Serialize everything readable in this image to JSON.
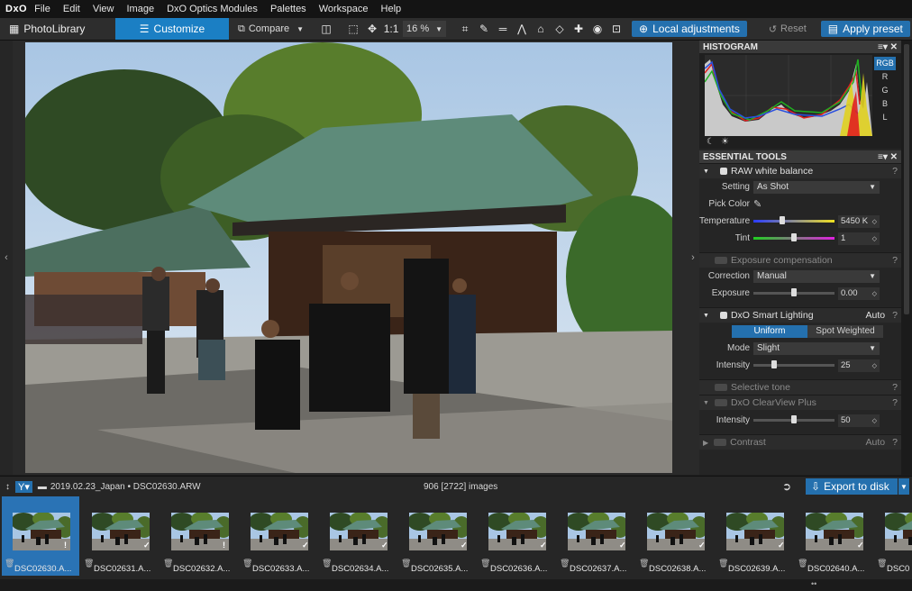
{
  "menu": {
    "logo": "DxO",
    "items": [
      "File",
      "Edit",
      "View",
      "Image",
      "DxO Optics Modules",
      "Palettes",
      "Workspace",
      "Help"
    ]
  },
  "toolbar": {
    "photolibrary": "PhotoLibrary",
    "customize": "Customize",
    "compare": "Compare",
    "one_to_one": "1:1",
    "zoom": "16 %",
    "local_adjustments": "Local adjustments",
    "reset": "Reset",
    "apply_preset": "Apply preset"
  },
  "histogram": {
    "title": "HISTOGRAM",
    "channels": [
      "RGB",
      "R",
      "G",
      "B",
      "L"
    ]
  },
  "essential_tools": {
    "title": "ESSENTIAL TOOLS",
    "raw_white_balance": {
      "title": "RAW white balance",
      "setting_label": "Setting",
      "setting_value": "As Shot",
      "pick_color_label": "Pick Color",
      "temperature_label": "Temperature",
      "temperature_value": "5450 K",
      "temperature_pos": 0.35,
      "tint_label": "Tint",
      "tint_value": "1",
      "tint_pos": 0.5
    },
    "exposure": {
      "title": "Exposure compensation",
      "correction_label": "Correction",
      "correction_value": "Manual",
      "exposure_label": "Exposure",
      "exposure_value": "0.00",
      "exposure_pos": 0.5
    },
    "smart_lighting": {
      "title": "DxO Smart Lighting",
      "state": "Auto",
      "mode_uniform": "Uniform",
      "mode_spot": "Spot Weighted",
      "mode_label": "Mode",
      "mode_value": "Slight",
      "intensity_label": "Intensity",
      "intensity_value": "25",
      "intensity_pos": 0.25
    },
    "selective_tone": {
      "title": "Selective tone"
    },
    "clearview": {
      "title": "DxO ClearView Plus",
      "intensity_label": "Intensity",
      "intensity_value": "50",
      "intensity_pos": 0.5
    },
    "contrast": {
      "title": "Contrast",
      "state": "Auto"
    }
  },
  "pathbar": {
    "sort": "↕",
    "path": "2019.02.23_Japan • DSC02630.ARW",
    "count": "906 [2722] images",
    "export": "Export to disk"
  },
  "filmstrip": {
    "thumbs": [
      {
        "name": "DSC02630.A...",
        "mark": "!"
      },
      {
        "name": "DSC02631.A...",
        "mark": "✓"
      },
      {
        "name": "DSC02632.A...",
        "mark": "!"
      },
      {
        "name": "DSC02633.A...",
        "mark": "✓"
      },
      {
        "name": "DSC02634.A...",
        "mark": "✓"
      },
      {
        "name": "DSC02635.A...",
        "mark": "✓"
      },
      {
        "name": "DSC02636.A...",
        "mark": "✓"
      },
      {
        "name": "DSC02637.A...",
        "mark": "✓"
      },
      {
        "name": "DSC02638.A...",
        "mark": "✓"
      },
      {
        "name": "DSC02639.A...",
        "mark": "✓"
      },
      {
        "name": "DSC02640.A...",
        "mark": "✓"
      },
      {
        "name": "DSC0",
        "mark": ""
      }
    ]
  }
}
